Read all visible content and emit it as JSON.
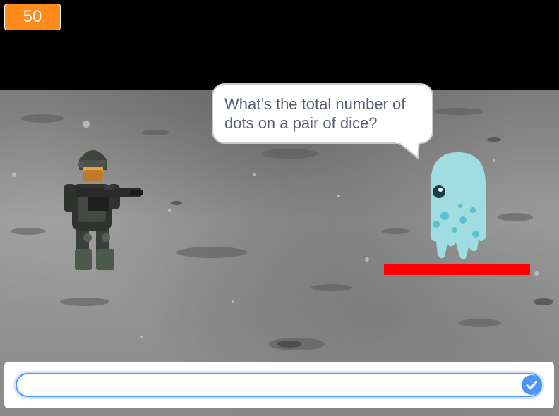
{
  "score": {
    "value": "50"
  },
  "speech": {
    "text": "What’s the total number of dots on a pair of dice?"
  },
  "answer": {
    "value": "",
    "submit_icon": "check-icon"
  },
  "enemy": {
    "health_fraction": 1.0
  },
  "colors": {
    "score_bg": "#ff8c1a",
    "health_bar": "#ff0000",
    "input_border": "#4c97ff",
    "bubble_text": "#575e75"
  }
}
